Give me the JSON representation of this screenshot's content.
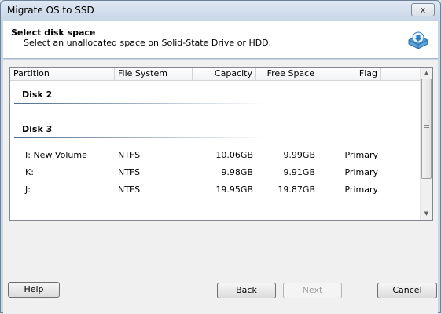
{
  "window": {
    "title": "Migrate OS to SSD",
    "close_glyph": "x"
  },
  "header": {
    "title": "Select disk space",
    "subtitle": "Select an unallocated space on Solid-State Drive or HDD.",
    "icon": "disk-download-icon"
  },
  "table": {
    "columns": [
      "Partition",
      "File System",
      "Capacity",
      "Free Space",
      "Flag"
    ],
    "disks": [
      {
        "label": "Disk 2",
        "partitions": []
      },
      {
        "label": "Disk 3",
        "partitions": [
          {
            "partition": "I:  New Volume",
            "file_system": "NTFS",
            "capacity": "10.06GB",
            "free_space": "9.99GB",
            "flag": "Primary"
          },
          {
            "partition": "K:",
            "file_system": "NTFS",
            "capacity": "9.98GB",
            "free_space": "9.91GB",
            "flag": "Primary"
          },
          {
            "partition": "J:",
            "file_system": "NTFS",
            "capacity": "19.95GB",
            "free_space": "19.87GB",
            "flag": "Primary"
          }
        ]
      }
    ]
  },
  "buttons": {
    "help": "Help",
    "back": "Back",
    "next": "Next",
    "cancel": "Cancel"
  }
}
